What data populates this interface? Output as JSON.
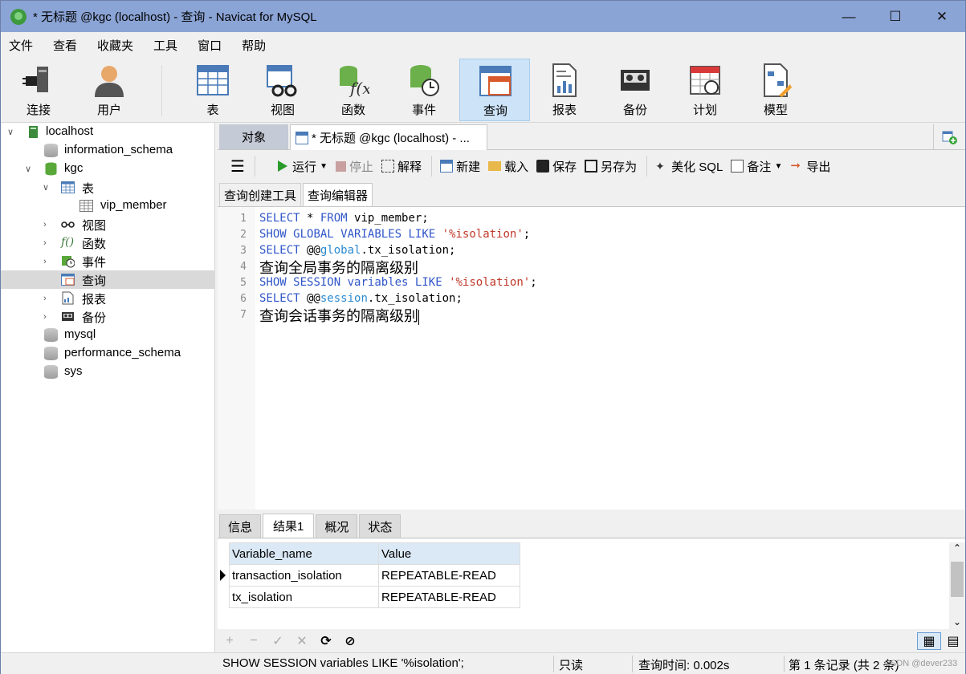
{
  "window": {
    "title": "* 无标题 @kgc (localhost) - 查询 - Navicat for MySQL"
  },
  "menu": [
    "文件",
    "查看",
    "收藏夹",
    "工具",
    "窗口",
    "帮助"
  ],
  "toolbar": [
    {
      "label": "连接",
      "icon": "connection-icon"
    },
    {
      "label": "用户",
      "icon": "user-icon"
    },
    {
      "label": "表",
      "icon": "table-icon"
    },
    {
      "label": "视图",
      "icon": "view-icon"
    },
    {
      "label": "函数",
      "icon": "function-icon"
    },
    {
      "label": "事件",
      "icon": "event-icon"
    },
    {
      "label": "查询",
      "icon": "query-icon",
      "active": true
    },
    {
      "label": "报表",
      "icon": "report-icon"
    },
    {
      "label": "备份",
      "icon": "backup-icon"
    },
    {
      "label": "计划",
      "icon": "schedule-icon"
    },
    {
      "label": "模型",
      "icon": "model-icon"
    }
  ],
  "tree": [
    {
      "label": "localhost"
    },
    {
      "label": "information_schema"
    },
    {
      "label": "kgc"
    },
    {
      "label": "表"
    },
    {
      "label": "vip_member"
    },
    {
      "label": "视图"
    },
    {
      "label": "函数"
    },
    {
      "label": "事件"
    },
    {
      "label": "查询",
      "selected": true
    },
    {
      "label": "报表"
    },
    {
      "label": "备份"
    },
    {
      "label": "mysql"
    },
    {
      "label": "performance_schema"
    },
    {
      "label": "sys"
    }
  ],
  "tabs": {
    "objects": "对象",
    "query": "* 无标题 @kgc (localhost) - ..."
  },
  "query_toolbar": {
    "run": "运行",
    "stop": "停止",
    "explain": "解释",
    "new": "新建",
    "load": "载入",
    "save": "保存",
    "save_as": "另存为",
    "beautify": "美化 SQL",
    "note": "备注",
    "export": "导出"
  },
  "editor_tabs": [
    "查询创建工具",
    "查询编辑器"
  ],
  "editor": {
    "line_numbers": [
      "1",
      "2",
      "3",
      "4",
      "5",
      "6",
      "7"
    ],
    "lines": [
      "SELECT * FROM vip_member;",
      "SHOW GLOBAL VARIABLES LIKE '%isolation';",
      "SELECT @@global.tx_isolation;",
      "查询全局事务的隔离级别",
      "SHOW SESSION variables LIKE '%isolation';",
      "SELECT @@session.tx_isolation;",
      "查询会话事务的隔离级别"
    ]
  },
  "result_tabs": [
    "信息",
    "结果1",
    "概况",
    "状态"
  ],
  "result": {
    "columns": [
      "Variable_name",
      "Value"
    ],
    "rows": [
      [
        "transaction_isolation",
        "REPEATABLE-READ"
      ],
      [
        "tx_isolation",
        "REPEATABLE-READ"
      ]
    ]
  },
  "status": {
    "sql": "SHOW SESSION variables LIKE '%isolation';",
    "readonly": "只读",
    "query_time": "查询时间: 0.002s",
    "records": "第 1 条记录 (共 2 条)",
    "watermark": "CSDN @dever233"
  }
}
